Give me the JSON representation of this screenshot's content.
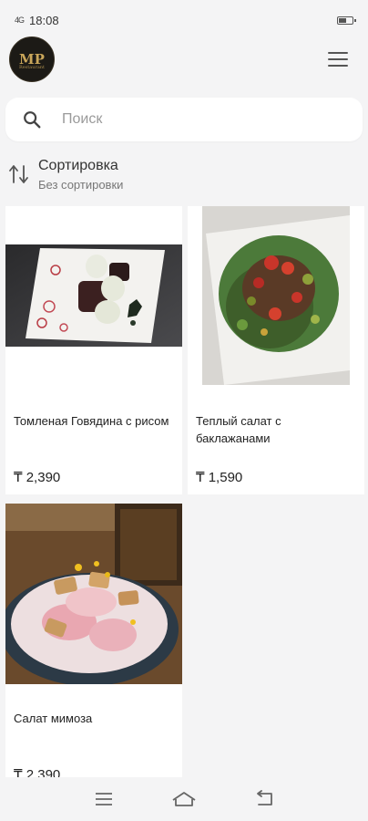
{
  "status_bar": {
    "signal": "4G",
    "time": "18:08"
  },
  "logo": {
    "monogram": "MP",
    "subtitle": "Restaurant"
  },
  "search": {
    "placeholder": "Поиск",
    "value": ""
  },
  "sort": {
    "title": "Сортировка",
    "subtitle": "Без сортировки"
  },
  "products": [
    {
      "name": "Томленая Говядина с рисом",
      "price": "₸ 2,390",
      "image": "braised-beef-rice-dish"
    },
    {
      "name": "Теплый салат с баклажанами",
      "price": "₸ 1,590",
      "image": "warm-eggplant-salad"
    },
    {
      "name": "Салат мимоза",
      "price": "₸ 2,390",
      "image": "mimosa-salad-bowl"
    }
  ],
  "icons": {
    "search": "search-icon",
    "sort": "sort-arrows-icon",
    "menu": "hamburger-menu-icon",
    "nav": [
      "recent-apps-icon",
      "home-icon",
      "back-icon"
    ]
  },
  "colors": {
    "background": "#f4f4f5",
    "card": "#ffffff",
    "logo_bg": "#1c1a16",
    "logo_gold": "#c9a65a"
  }
}
